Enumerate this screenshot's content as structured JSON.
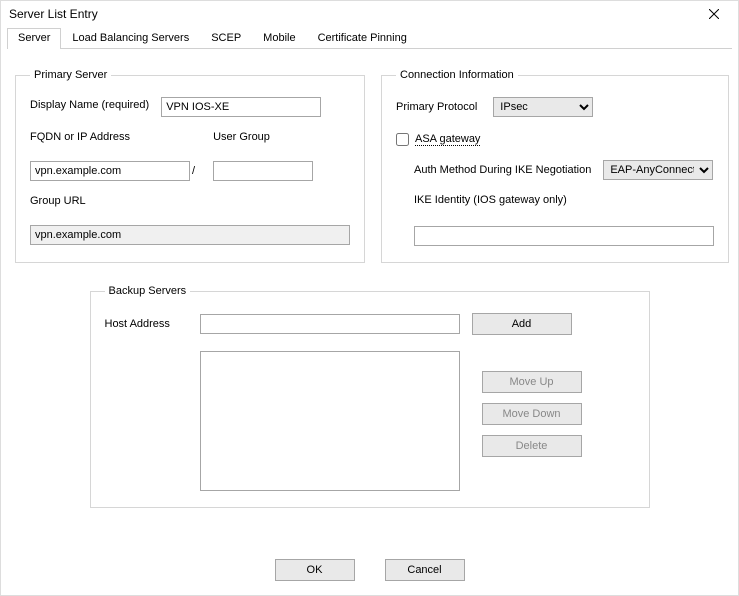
{
  "window": {
    "title": "Server List Entry"
  },
  "tabs": [
    "Server",
    "Load Balancing Servers",
    "SCEP",
    "Mobile",
    "Certificate Pinning"
  ],
  "primaryServer": {
    "legend": "Primary Server",
    "displayNameLabel": "Display Name (required)",
    "displayNameValue": "VPN IOS-XE",
    "fqdnLabel": "FQDN or IP Address",
    "fqdnValue": "vpn.example.com",
    "userGroupLabel": "User Group",
    "userGroupValue": "",
    "groupUrlLabel": "Group URL",
    "groupUrlValue": "vpn.example.com"
  },
  "connInfo": {
    "legend": "Connection Information",
    "primaryProtocolLabel": "Primary Protocol",
    "primaryProtocolValue": "IPsec",
    "asaGatewayLabel": "ASA gateway",
    "asaGatewayChecked": false,
    "authMethodLabel": "Auth Method During IKE Negotiation",
    "authMethodValue": "EAP-AnyConnect",
    "ikeIdentityLabel": "IKE Identity (IOS gateway only)",
    "ikeIdentityValue": ""
  },
  "backup": {
    "legend": "Backup Servers",
    "hostAddressLabel": "Host Address",
    "hostAddressValue": "",
    "addLabel": "Add",
    "moveUpLabel": "Move Up",
    "moveDownLabel": "Move Down",
    "deleteLabel": "Delete"
  },
  "buttons": {
    "ok": "OK",
    "cancel": "Cancel"
  }
}
